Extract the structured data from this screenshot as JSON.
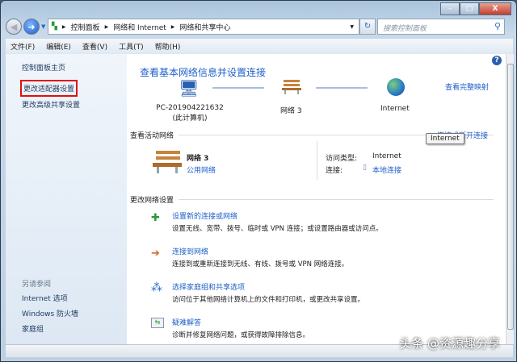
{
  "window": {
    "minimize": "–",
    "maximize": "□",
    "close": "X"
  },
  "address": {
    "crumbs": [
      "控制面板",
      "网络和 Internet",
      "网络和共享中心"
    ],
    "search_placeholder": "搜索控制面板"
  },
  "menu": [
    "文件(F)",
    "编辑(E)",
    "查看(V)",
    "工具(T)",
    "帮助(H)"
  ],
  "sidebar": {
    "items": [
      "控制面板主页",
      "更改适配器设置",
      "更改高级共享设置"
    ],
    "see_also": "另请参阅",
    "see_also_items": [
      "Internet 选项",
      "Windows 防火墙",
      "家庭组"
    ]
  },
  "main": {
    "title": "查看基本网络信息并设置连接",
    "view_full_map": "查看完整映射",
    "map": {
      "computer": "PC-201904221632",
      "computer_sub": "(此计算机)",
      "network": "网络  3",
      "internet": "Internet"
    },
    "active_header": "查看活动网络",
    "connect_disconnect": "连接或断开连接",
    "tooltip": "Internet",
    "active": {
      "name": "网络  3",
      "type": "公用网络",
      "access_label": "访问类型:",
      "access_value": "Internet",
      "conn_label": "连接:",
      "conn_value": "本地连接"
    },
    "change_header": "更改网络设置",
    "tasks": [
      {
        "title": "设置新的连接或网络",
        "desc": "设置无线、宽带、拨号、临时或 VPN 连接；或设置路由器或访问点。"
      },
      {
        "title": "连接到网络",
        "desc": "连接到或重新连接到无线、有线、拨号或 VPN 网络连接。"
      },
      {
        "title": "选择家庭组和共享选项",
        "desc": "访问位于其他网络计算机上的文件和打印机，或更改共享设置。"
      },
      {
        "title": "疑难解答",
        "desc": "诊断并修复网络问题，或获得故障排除信息。"
      }
    ]
  },
  "watermark": "头条 @资源趣分享"
}
